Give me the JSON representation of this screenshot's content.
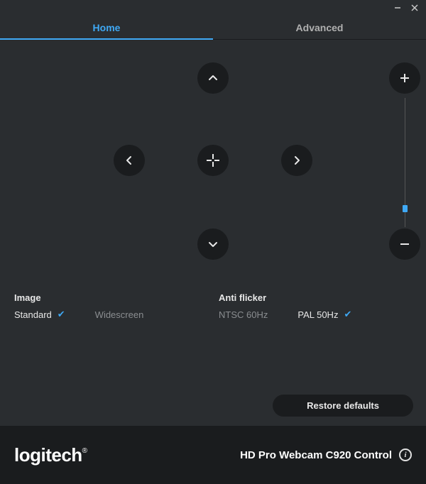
{
  "tabs": {
    "home": "Home",
    "advanced": "Advanced",
    "active": "home"
  },
  "zoom": {
    "slider_pct": 88
  },
  "image": {
    "label": "Image",
    "options": {
      "standard": "Standard",
      "widescreen": "Widescreen"
    },
    "selected": "standard"
  },
  "anti_flicker": {
    "label": "Anti flicker",
    "options": {
      "ntsc": "NTSC 60Hz",
      "pal": "PAL 50Hz"
    },
    "selected": "pal"
  },
  "restore": "Restore defaults",
  "footer": {
    "brand": "logitech",
    "product": "HD Pro Webcam C920 Control"
  }
}
